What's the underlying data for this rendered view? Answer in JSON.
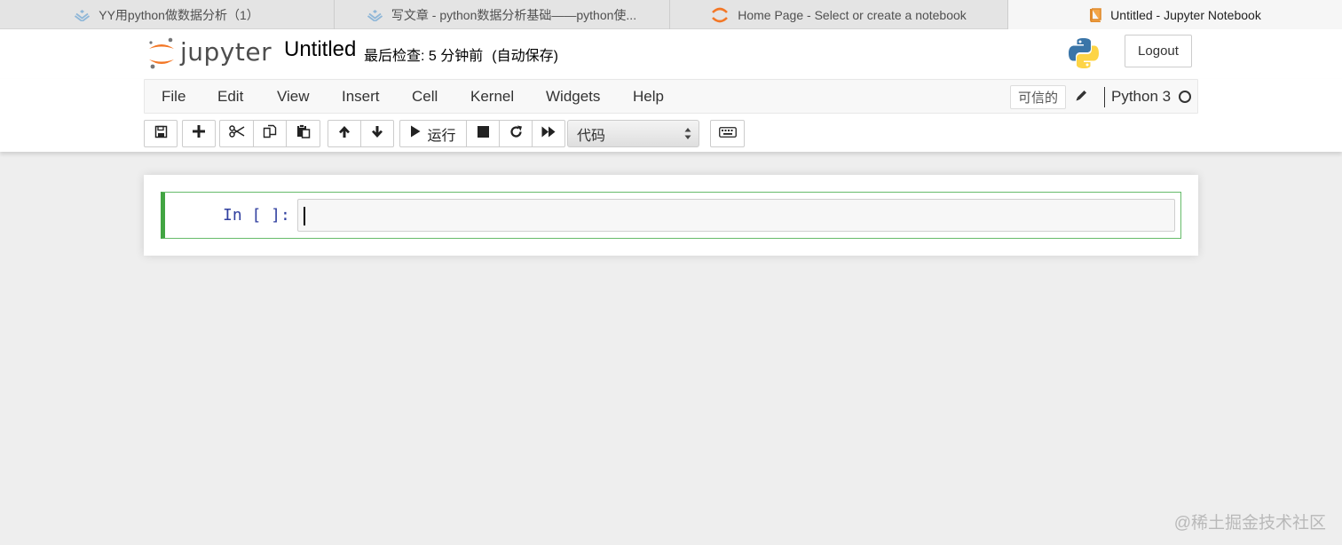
{
  "browser": {
    "tabs": [
      {
        "label": "YY用python做数据分析（1）",
        "icon": "juejin-icon"
      },
      {
        "label": "写文章 - python数据分析基础——python使...",
        "icon": "juejin-icon"
      },
      {
        "label": "Home Page - Select or create a notebook",
        "icon": "jupyter-icon"
      },
      {
        "label": "Untitled - Jupyter Notebook",
        "icon": "notebook-icon",
        "active": true
      }
    ]
  },
  "header": {
    "logo_text": "jupyter",
    "notebook_title": "Untitled",
    "checkpoint": "最后检查: 5 分钟前",
    "autosave": "(自动保存)",
    "logout_label": "Logout"
  },
  "menubar": {
    "items": [
      "File",
      "Edit",
      "View",
      "Insert",
      "Cell",
      "Kernel",
      "Widgets",
      "Help"
    ],
    "trusted_label": "可信的",
    "kernel_name": "Python 3"
  },
  "toolbar": {
    "run_label": "运行",
    "cell_type": "代码"
  },
  "cell": {
    "prompt": "In [ ]:"
  },
  "watermark": "@稀土掘金技术社区",
  "colors": {
    "prompt": "#303f9f",
    "cell_border": "#66bb6a",
    "jupyter_orange": "#f37726"
  }
}
